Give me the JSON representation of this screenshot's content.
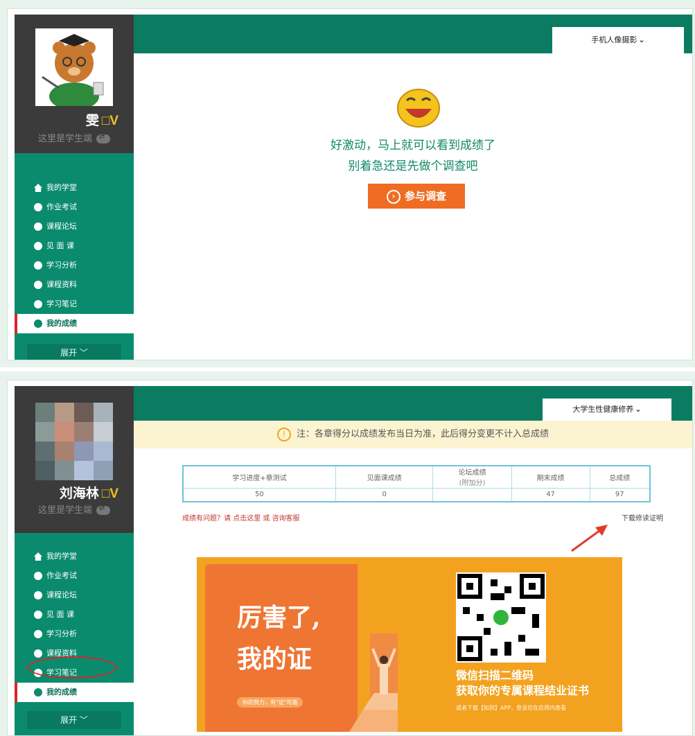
{
  "panel1": {
    "username": "雯",
    "badge": "□V",
    "role": "这里是学生端",
    "course": "手机人像摄影",
    "message_line1": "好激动，马上就可以看到成绩了",
    "message_line2": "别着急还是先做个调查吧",
    "survey_button": "参与调查",
    "expand": "展开 ﹀"
  },
  "panel2": {
    "username": "刘海林",
    "badge": "□V",
    "role": "这里是学生端",
    "course": "大学生性健康修养",
    "notice": "注：各章得分以成绩发布当日为准，此后得分变更不计入总成绩",
    "table": {
      "headers": [
        "学习进度+章测试",
        "见面课成绩",
        "论坛成绩",
        "期末成绩",
        "总成绩"
      ],
      "forum_sub": "(附加分)",
      "values": [
        "50",
        "0",
        "",
        "47",
        "97"
      ]
    },
    "help_prefix": "成绩有问题？请",
    "help_link1": "点击这里",
    "help_or": "或",
    "help_link2": "咨询客服",
    "download": "下载修读证明",
    "banner": {
      "big1": "厉害了,",
      "big2": "我的证",
      "tag": "你的努力，有\"证\"可循",
      "scan_line1": "微信扫描二维码",
      "scan_line2": "获取你的专属课程结业证书",
      "scan_sub": "或者下载【知到】APP，登录后在应用内查看"
    },
    "expand": "展开 ﹀"
  },
  "nav": [
    "我的学堂",
    "作业考试",
    "课程论坛",
    "见 面 课",
    "学习分析",
    "课程资料",
    "学习笔记",
    "我的成绩"
  ],
  "colors": {
    "green": "#0b8b6e",
    "orange": "#ee6d22",
    "dark": "#3a3a3a"
  }
}
